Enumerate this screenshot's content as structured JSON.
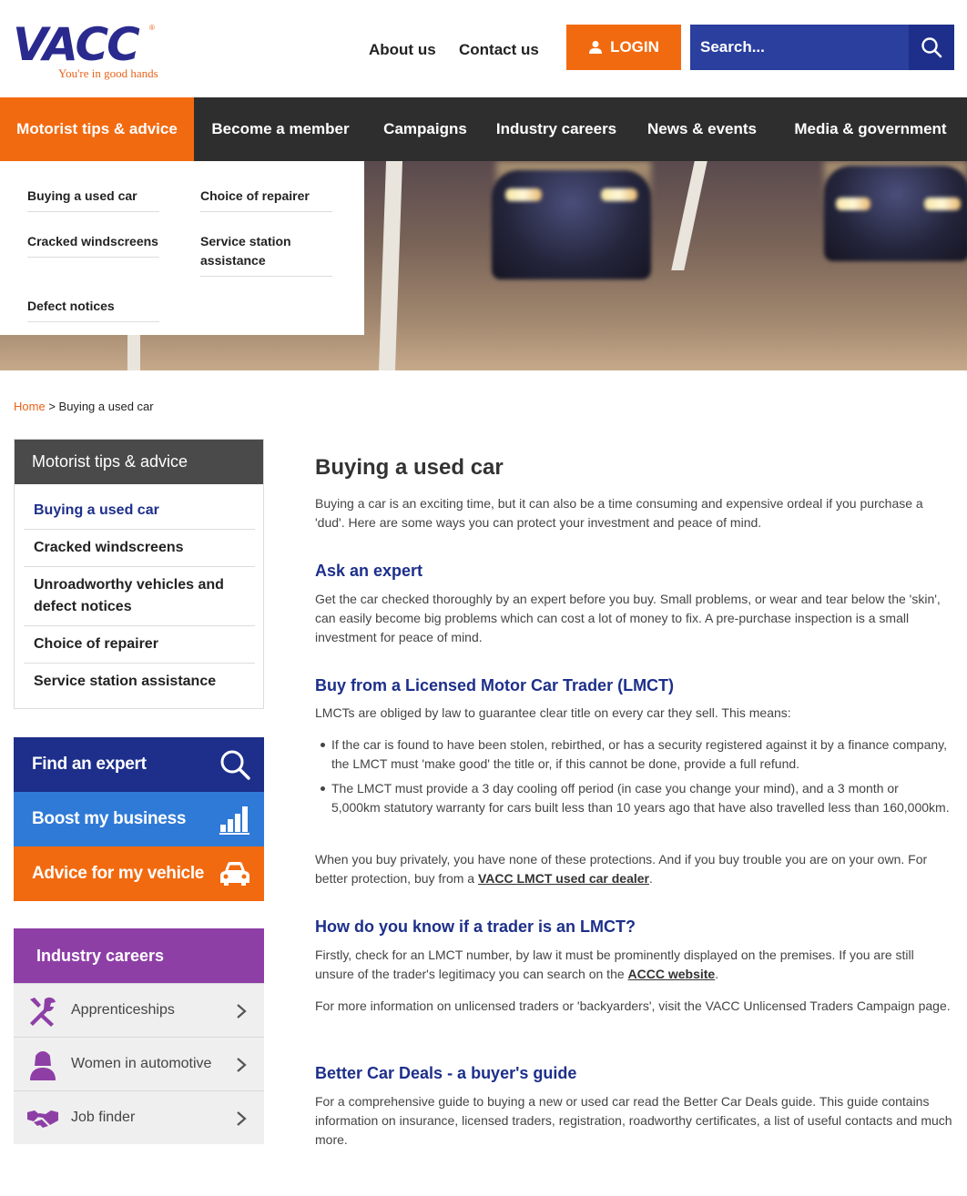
{
  "brand": {
    "logo_text": "VACC",
    "tagline": "You're in good hands",
    "accent": "#f26a10",
    "navy": "#1d2f8a",
    "purple": "#8e3fa6"
  },
  "header": {
    "about": "About us",
    "contact": "Contact us",
    "login": "LOGIN",
    "search_placeholder": "Search..."
  },
  "nav": {
    "items": [
      "Motorist tips & advice",
      "Become a member",
      "Campaigns",
      "Industry careers",
      "News & events",
      "Media & government"
    ]
  },
  "dropdown": {
    "items": [
      "Buying a used car",
      "Choice of repairer",
      "Cracked windscreens",
      "Service station assistance",
      "Defect notices"
    ]
  },
  "breadcrumb": {
    "home": "Home",
    "separator": ">",
    "current": "Buying a used car"
  },
  "sidebar": {
    "title": "Motorist tips & advice",
    "items": [
      "Buying a used car",
      "Cracked windscreens",
      "Unroadworthy vehicles and defect notices",
      "Choice of repairer",
      "Service station assistance"
    ]
  },
  "tiles": {
    "find": "Find an expert",
    "boost": "Boost my business",
    "advice": "Advice for my vehicle"
  },
  "careers": {
    "title": "Industry careers",
    "items": [
      "Apprenticeships",
      "Women in automotive",
      "Job finder"
    ]
  },
  "content": {
    "title": "Buying a used car",
    "intro": "Buying a car is an exciting time, but it can also be a time consuming and expensive ordeal if you purchase a 'dud'. Here are some ways you can protect your investment and peace of mind.",
    "s1_title": "Ask an expert",
    "s1_body": "Get the car checked thoroughly by an expert before you buy. Small problems, or wear and tear below the 'skin', can easily become big problems which can cost a lot of money to fix. A pre-purchase inspection is a small investment for peace of mind.",
    "s2_title": "Buy from a Licensed Motor Car Trader (LMCT)",
    "s2_body": "LMCTs are obliged by law to guarantee clear title on every car they sell. This means:",
    "s2_bullet1": "If the car is found to have been stolen, rebirthed, or has a security registered against it by a finance company, the LMCT must 'make good' the title or, if this cannot be done, provide a full refund.",
    "s2_bullet2": "The LMCT must provide a 3 day cooling off period (in case you change your mind), and a 3 month or 5,000km statutory warranty for cars built less than 10 years ago that have also travelled less than 160,000km.",
    "s2_after": "When you buy privately, you have none of these protections. And if you buy trouble you are on your own. For better protection, buy from a ",
    "s2_link": "VACC LMCT used car dealer",
    "s3_title": "How do you know if a trader is an LMCT?",
    "s3_body": "Firstly, check for an LMCT number, by law it must be prominently displayed on the premises. If you are still unsure of the trader's legitimacy you can search on the ",
    "s3_link": "ACCC website",
    "s3_body2": "For more information on unlicensed traders or 'backyarders', visit the VACC Unlicensed Traders Campaign page.",
    "s4_title": "Better Car Deals - a buyer's guide",
    "s4_body": "For a comprehensive guide to buying a new or used car read the Better Car Deals guide. This guide contains information on insurance, licensed traders, registration, roadworthy certificates, a list of useful contacts and much more."
  }
}
